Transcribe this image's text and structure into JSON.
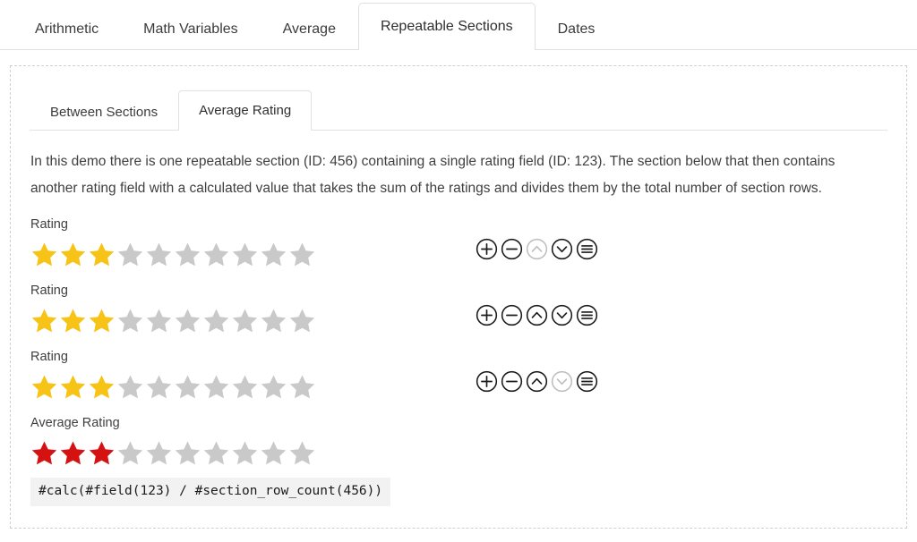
{
  "outer_tabs": [
    {
      "label": "Arithmetic",
      "active": false
    },
    {
      "label": "Math Variables",
      "active": false
    },
    {
      "label": "Average",
      "active": false
    },
    {
      "label": "Repeatable Sections",
      "active": true
    },
    {
      "label": "Dates",
      "active": false
    }
  ],
  "inner_tabs": [
    {
      "label": "Between Sections",
      "active": false
    },
    {
      "label": "Average Rating",
      "active": true
    }
  ],
  "intro": "In this demo there is one repeatable section (ID: 456) containing a single rating field (ID: 123). The section below that then contains another rating field with a calculated value that takes the sum of the ratings and divides them by the total number of section rows.",
  "colors": {
    "star_gold": "#F6C316",
    "star_red": "#D51111",
    "star_empty": "#C9C9C9",
    "icon_active": "#1b1b1b",
    "icon_disabled": "#bfbfbf",
    "tab_border": "#e0e0e0",
    "dashed_border": "#cfcfcf",
    "code_bg": "#f2f2f2",
    "text": "#3f3f3f"
  },
  "section_rows": [
    {
      "label": "Rating",
      "stars_total": 10,
      "stars_filled": 3,
      "star_color": "gold",
      "controls": [
        {
          "name": "add-section-row",
          "icon": "plus-circle-icon",
          "enabled": true
        },
        {
          "name": "remove-section-row",
          "icon": "minus-circle-icon",
          "enabled": true
        },
        {
          "name": "move-section-row-up",
          "icon": "chevron-up-circle-icon",
          "enabled": false
        },
        {
          "name": "move-section-row-down",
          "icon": "chevron-down-circle-icon",
          "enabled": true
        },
        {
          "name": "section-row-menu",
          "icon": "hamburger-circle-icon",
          "enabled": true
        }
      ]
    },
    {
      "label": "Rating",
      "stars_total": 10,
      "stars_filled": 3,
      "star_color": "gold",
      "controls": [
        {
          "name": "add-section-row",
          "icon": "plus-circle-icon",
          "enabled": true
        },
        {
          "name": "remove-section-row",
          "icon": "minus-circle-icon",
          "enabled": true
        },
        {
          "name": "move-section-row-up",
          "icon": "chevron-up-circle-icon",
          "enabled": true
        },
        {
          "name": "move-section-row-down",
          "icon": "chevron-down-circle-icon",
          "enabled": true
        },
        {
          "name": "section-row-menu",
          "icon": "hamburger-circle-icon",
          "enabled": true
        }
      ]
    },
    {
      "label": "Rating",
      "stars_total": 10,
      "stars_filled": 3,
      "star_color": "gold",
      "controls": [
        {
          "name": "add-section-row",
          "icon": "plus-circle-icon",
          "enabled": true
        },
        {
          "name": "remove-section-row",
          "icon": "minus-circle-icon",
          "enabled": true
        },
        {
          "name": "move-section-row-up",
          "icon": "chevron-up-circle-icon",
          "enabled": true
        },
        {
          "name": "move-section-row-down",
          "icon": "chevron-down-circle-icon",
          "enabled": false
        },
        {
          "name": "section-row-menu",
          "icon": "hamburger-circle-icon",
          "enabled": true
        }
      ]
    }
  ],
  "average": {
    "label": "Average Rating",
    "stars_total": 10,
    "stars_filled": 3,
    "star_color": "red"
  },
  "code": "#calc(#field(123) / #section_row_count(456))"
}
